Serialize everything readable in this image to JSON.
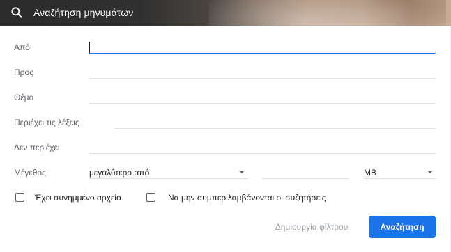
{
  "search": {
    "placeholder": "Αναζήτηση μηνυμάτων"
  },
  "form": {
    "from_label": "Από",
    "to_label": "Προς",
    "subject_label": "Θέμα",
    "has_words_label": "Περιέχει τις λέξεις",
    "doesnt_have_label": "Δεν περιέχει",
    "size_label": "Μέγεθος",
    "size_operator": "μεγαλύτερο από",
    "size_unit": "MB",
    "has_attachment_label": "Έχει συνημμένο αρχείο",
    "exclude_chats_label": "Να μην συμπεριλαμβάνονται οι συζητήσεις"
  },
  "buttons": {
    "create_filter": "Δημιουργία φίλτρου",
    "search": "Αναζήτηση"
  },
  "colors": {
    "accent": "#1a73e8",
    "header_dark": "#2b2b2b"
  },
  "icons": {
    "search": "search-icon",
    "dropdown": "chevron-down-icon"
  }
}
